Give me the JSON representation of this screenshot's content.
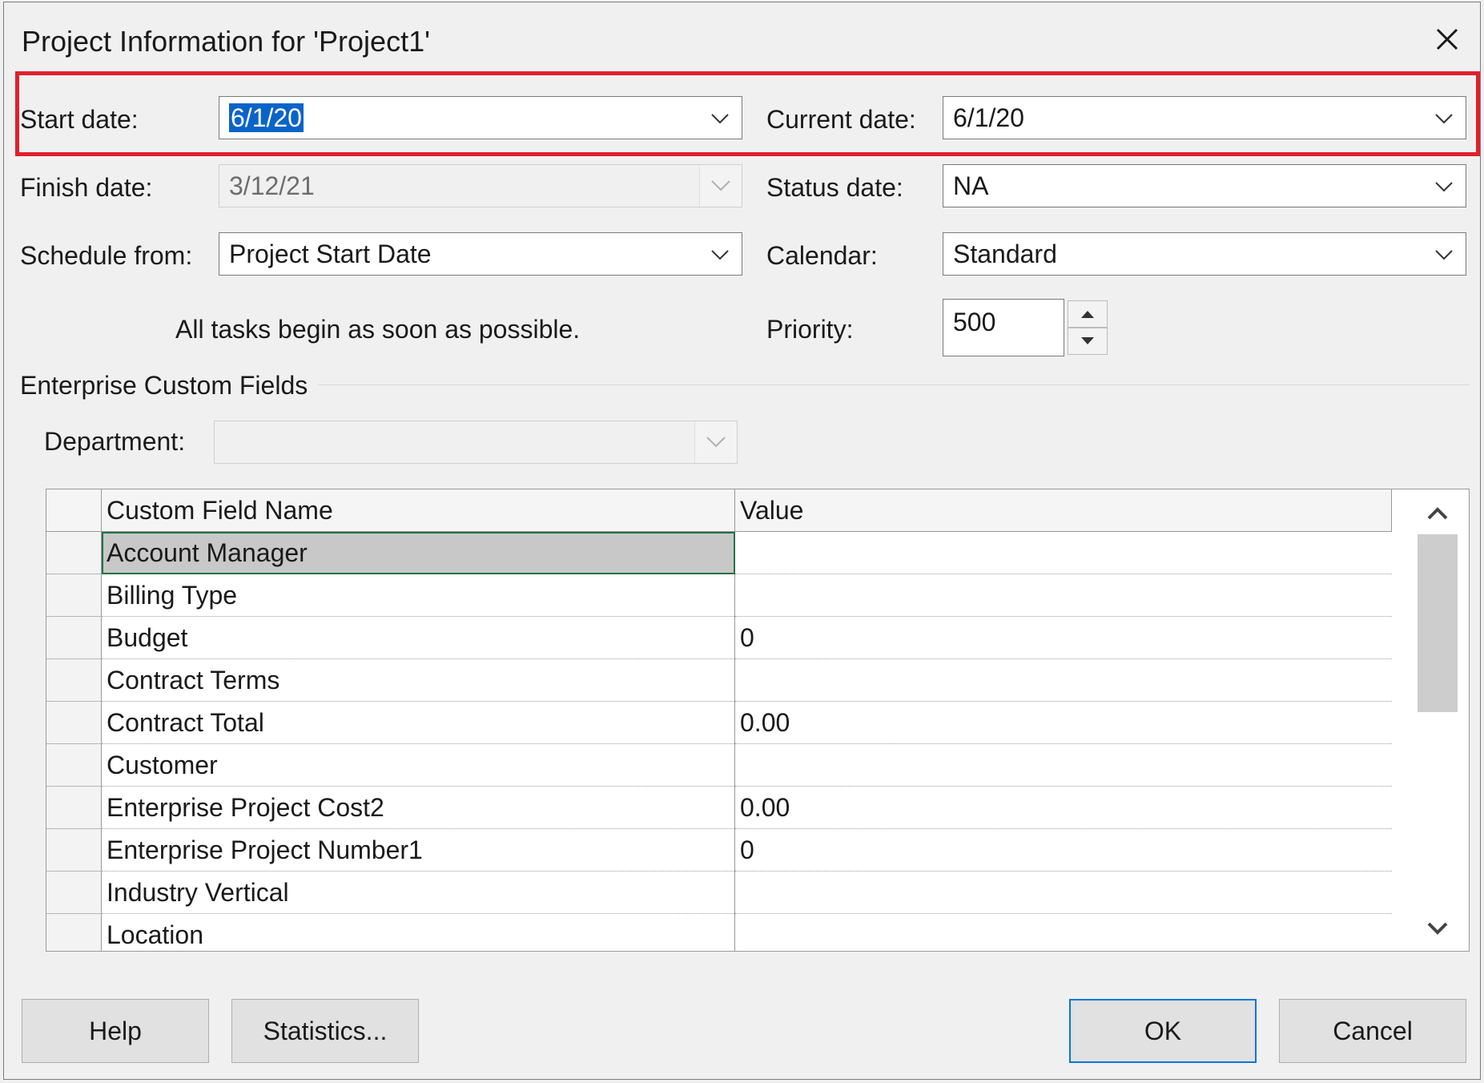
{
  "window": {
    "title": "Project Information for 'Project1'"
  },
  "fields": {
    "start_date": {
      "label": "Start date:",
      "value": "6/1/20"
    },
    "current_date": {
      "label": "Current date:",
      "value": "6/1/20"
    },
    "finish_date": {
      "label": "Finish date:",
      "value": "3/12/21"
    },
    "status_date": {
      "label": "Status date:",
      "value": "NA"
    },
    "schedule_from": {
      "label": "Schedule from:",
      "value": "Project Start Date"
    },
    "calendar": {
      "label": "Calendar:",
      "value": "Standard"
    },
    "schedule_note": "All tasks begin as soon as possible.",
    "priority": {
      "label": "Priority:",
      "value": "500"
    }
  },
  "enterprise": {
    "section_title": "Enterprise Custom Fields",
    "department_label": "Department:",
    "department_value": "",
    "columns": [
      "Custom Field Name",
      "Value"
    ],
    "rows": [
      {
        "name": "Account Manager",
        "value": ""
      },
      {
        "name": "Billing Type",
        "value": ""
      },
      {
        "name": "Budget",
        "value": "0"
      },
      {
        "name": "Contract Terms",
        "value": ""
      },
      {
        "name": "Contract Total",
        "value": "0.00"
      },
      {
        "name": "Customer",
        "value": ""
      },
      {
        "name": "Enterprise Project Cost2",
        "value": "0.00"
      },
      {
        "name": "Enterprise Project Number1",
        "value": "0"
      },
      {
        "name": "Industry Vertical",
        "value": ""
      },
      {
        "name": "Location",
        "value": ""
      }
    ]
  },
  "buttons": {
    "help": "Help",
    "statistics": "Statistics...",
    "ok": "OK",
    "cancel": "Cancel"
  },
  "colors": {
    "highlight": "#e0202e",
    "selection": "#0a64c8",
    "default_button_border": "#0078d7"
  }
}
